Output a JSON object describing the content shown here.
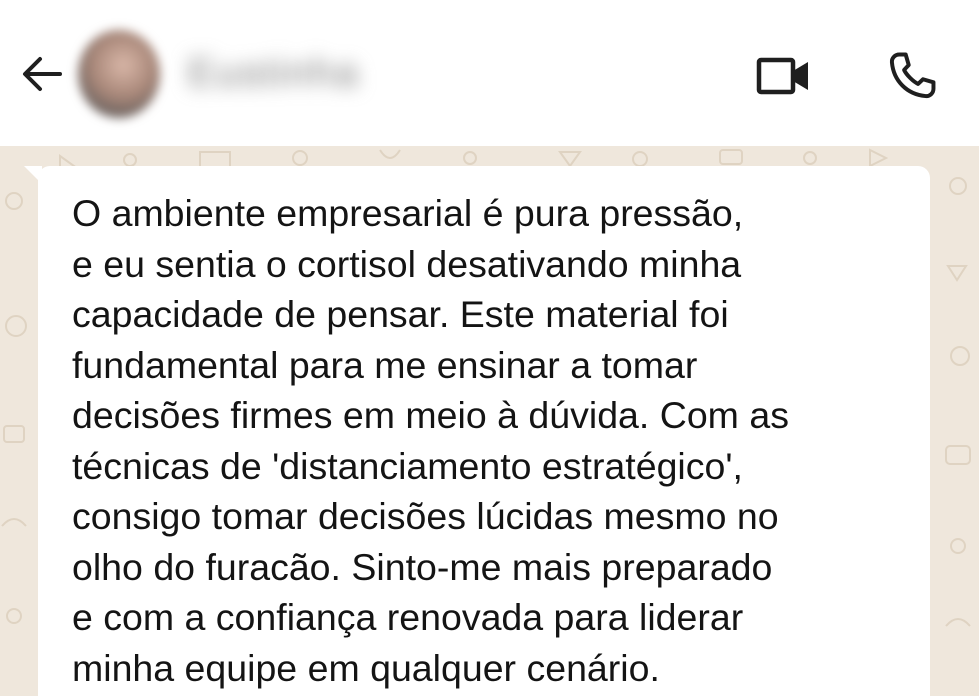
{
  "header": {
    "contact_name": "Eustinha",
    "icons": {
      "back": "arrow-left-icon",
      "video": "video-camera-icon",
      "call": "phone-icon"
    }
  },
  "message": {
    "text": "O ambiente empresarial é pura pressão,\ne eu sentia o cortisol desativando minha\ncapacidade de pensar. Este material foi\nfundamental para me ensinar a tomar\ndecisões firmes em meio à dúvida. Com as\ntécnicas de 'distanciamento estratégico',\nconsigo tomar decisões lúcidas mesmo no\nolho do furacão. Sinto-me mais preparado\ne com a confiança renovada para liderar\nminha equipe em qualquer cenário."
  },
  "colors": {
    "header_bg": "#ffffff",
    "chat_bg": "#efe7dc",
    "bubble_bg": "#ffffff",
    "text": "#141414",
    "icon": "#1f1f1f"
  }
}
